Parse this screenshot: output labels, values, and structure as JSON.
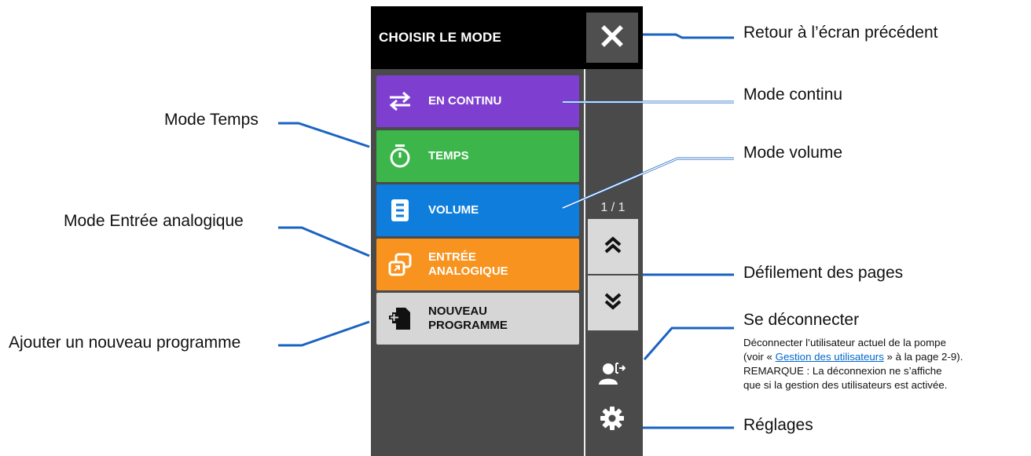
{
  "header": {
    "title": "CHOISIR LE MODE",
    "close_icon": "close-icon"
  },
  "modes": [
    {
      "label": "EN CONTINU",
      "icon": "continuous-arrows-icon",
      "color": "#7e3fd0"
    },
    {
      "label": "TEMPS",
      "icon": "stopwatch-icon",
      "color": "#3cb54a"
    },
    {
      "label": "VOLUME",
      "icon": "volume-doc-icon",
      "color": "#0f7ddc"
    },
    {
      "label": "ENTRÉE\nANALOGIQUE",
      "icon": "analog-input-icon",
      "color": "#f7931e"
    },
    {
      "label": "NOUVEAU\nPROGRAMME",
      "icon": "new-program-icon",
      "color": "#d6d6d6"
    }
  ],
  "pagination": {
    "counter": "1 / 1"
  },
  "callouts": {
    "back": "Retour à l’écran précédent",
    "continuous": "Mode continu",
    "time": "Mode Temps",
    "volume": "Mode volume",
    "analog": "Mode Entrée analogique",
    "scroll": "Défilement des pages",
    "logout": "Se déconnecter",
    "logout_desc_1": "Déconnecter l’utilisateur actuel de la pompe",
    "logout_desc_2_pre": "(voir « ",
    "logout_desc_2_link": "Gestion des utilisateurs",
    "logout_desc_2_post": " » à la page 2-9).",
    "logout_desc_3": "REMARQUE : La déconnexion ne s’affiche",
    "logout_desc_4": "que si la gestion des utilisateurs est activée.",
    "new_program": "Ajouter un nouveau programme",
    "settings": "Réglages"
  },
  "colors": {
    "leader_line": "#1a63c2",
    "header_bg": "#000000",
    "screen_bg": "#4a4a4a"
  }
}
